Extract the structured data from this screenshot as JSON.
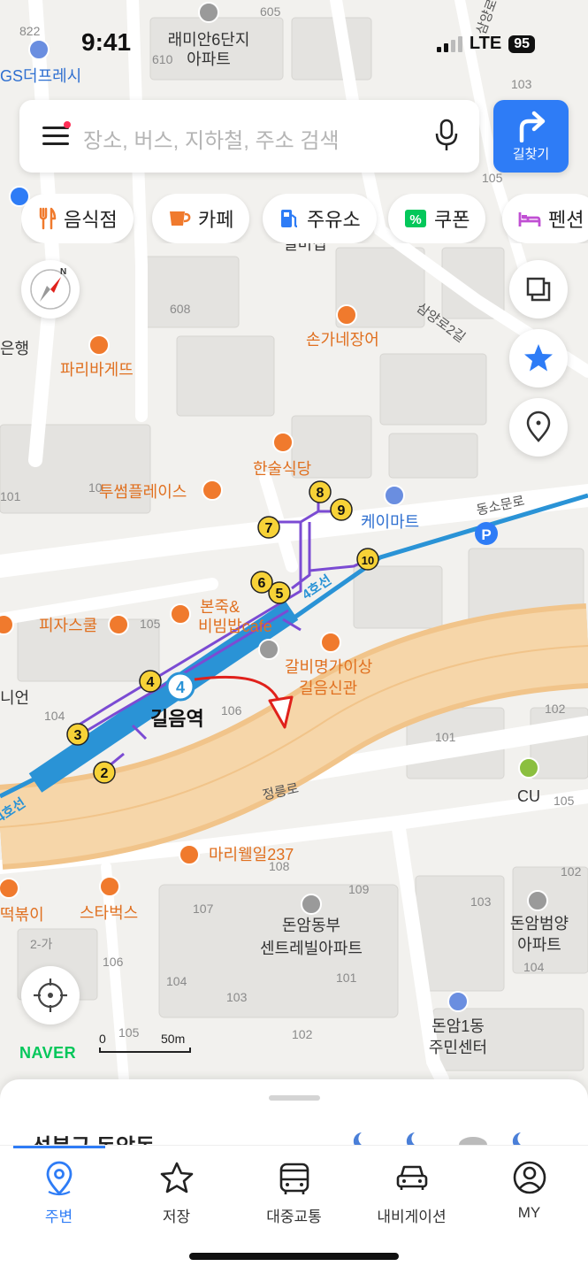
{
  "status_bar": {
    "time": "9:41",
    "network": "LTE",
    "battery": "95"
  },
  "search": {
    "placeholder": "장소, 버스, 지하철, 주소 검색"
  },
  "route_button": {
    "label": "길찾기"
  },
  "categories": [
    {
      "label": "음식점",
      "icon": "fork-knife-icon",
      "color": "#f07a2d"
    },
    {
      "label": "카페",
      "icon": "coffee-cup-icon",
      "color": "#f07a2d"
    },
    {
      "label": "주유소",
      "icon": "fuel-pump-icon",
      "color": "#2e7cf6"
    },
    {
      "label": "쿠폰",
      "icon": "percent-coupon-icon",
      "color": "#03c75a"
    },
    {
      "label": "펜션",
      "icon": "bed-icon",
      "color": "#c04fd3"
    }
  ],
  "map": {
    "station": {
      "name": "길음역",
      "line_badge": "4",
      "line_label": "4호선"
    },
    "exits": [
      "2",
      "3",
      "4",
      "5",
      "6",
      "7",
      "8",
      "9",
      "10"
    ],
    "places": {
      "cafe_tousome": "투썸플레이스",
      "paris_baguette": "파리바게뜨",
      "songane": "손가네장어",
      "hansul": "한술식당",
      "kmart": "케이마트",
      "pizza_school": "피자스쿨",
      "bonjuk_1": "본죽&",
      "bonjuk_2": "비빔밥cafe",
      "galbi_1": "갈비명가이상",
      "galbi_2": "길음신관",
      "mariwell": "마리웰일237",
      "starbucks": "스타벅스",
      "tteokbokki": "떡볶이",
      "gs_fresh": "GS더프레시",
      "raemian_1": "래미안6단지",
      "raemian_2": "아파트",
      "donam_bu_1": "돈암동부",
      "donam_bu_2": "센트레빌아파트",
      "donam_beom_1": "돈암범양",
      "donam_beom_2": "아파트",
      "donam_center_1": "돈암1동",
      "donam_center_2": "주민센터",
      "cu": "CU",
      "union": "니언",
      "bank": "은행",
      "giumsik": "일미집"
    },
    "roads": {
      "dongso": "동소문로",
      "jeongneung": "정릉로",
      "samyang": "삼양로2길",
      "samyang_top": "삼양로"
    },
    "building_numbers": {
      "b822": "822",
      "b605": "605",
      "b610": "610",
      "b103a": "103",
      "b105a": "105",
      "b608": "608",
      "b101a": "101",
      "b10": "10",
      "b105b": "105",
      "b104a": "104",
      "b106a": "106",
      "b102a": "102",
      "b101b": "101",
      "b105c": "105",
      "b102b": "102",
      "b103b": "103",
      "b104b": "104",
      "b108": "108",
      "b109": "109",
      "b107": "107",
      "b106b": "106",
      "b104c": "104",
      "b103c": "103",
      "b101c": "101",
      "b102c": "102",
      "b105d": "105",
      "b2ga": "2-가"
    }
  },
  "logo": "NAVER",
  "scale": {
    "zero": "0",
    "distance": "50m"
  },
  "sheet": {
    "title": "성북구 돈암동"
  },
  "tabs": [
    {
      "label": "주변",
      "icon": "location-pin-icon",
      "active": true
    },
    {
      "label": "저장",
      "icon": "star-icon",
      "active": false
    },
    {
      "label": "대중교통",
      "icon": "bus-icon",
      "active": false
    },
    {
      "label": "내비게이션",
      "icon": "car-icon",
      "active": false
    },
    {
      "label": "MY",
      "icon": "profile-icon",
      "active": false
    }
  ]
}
